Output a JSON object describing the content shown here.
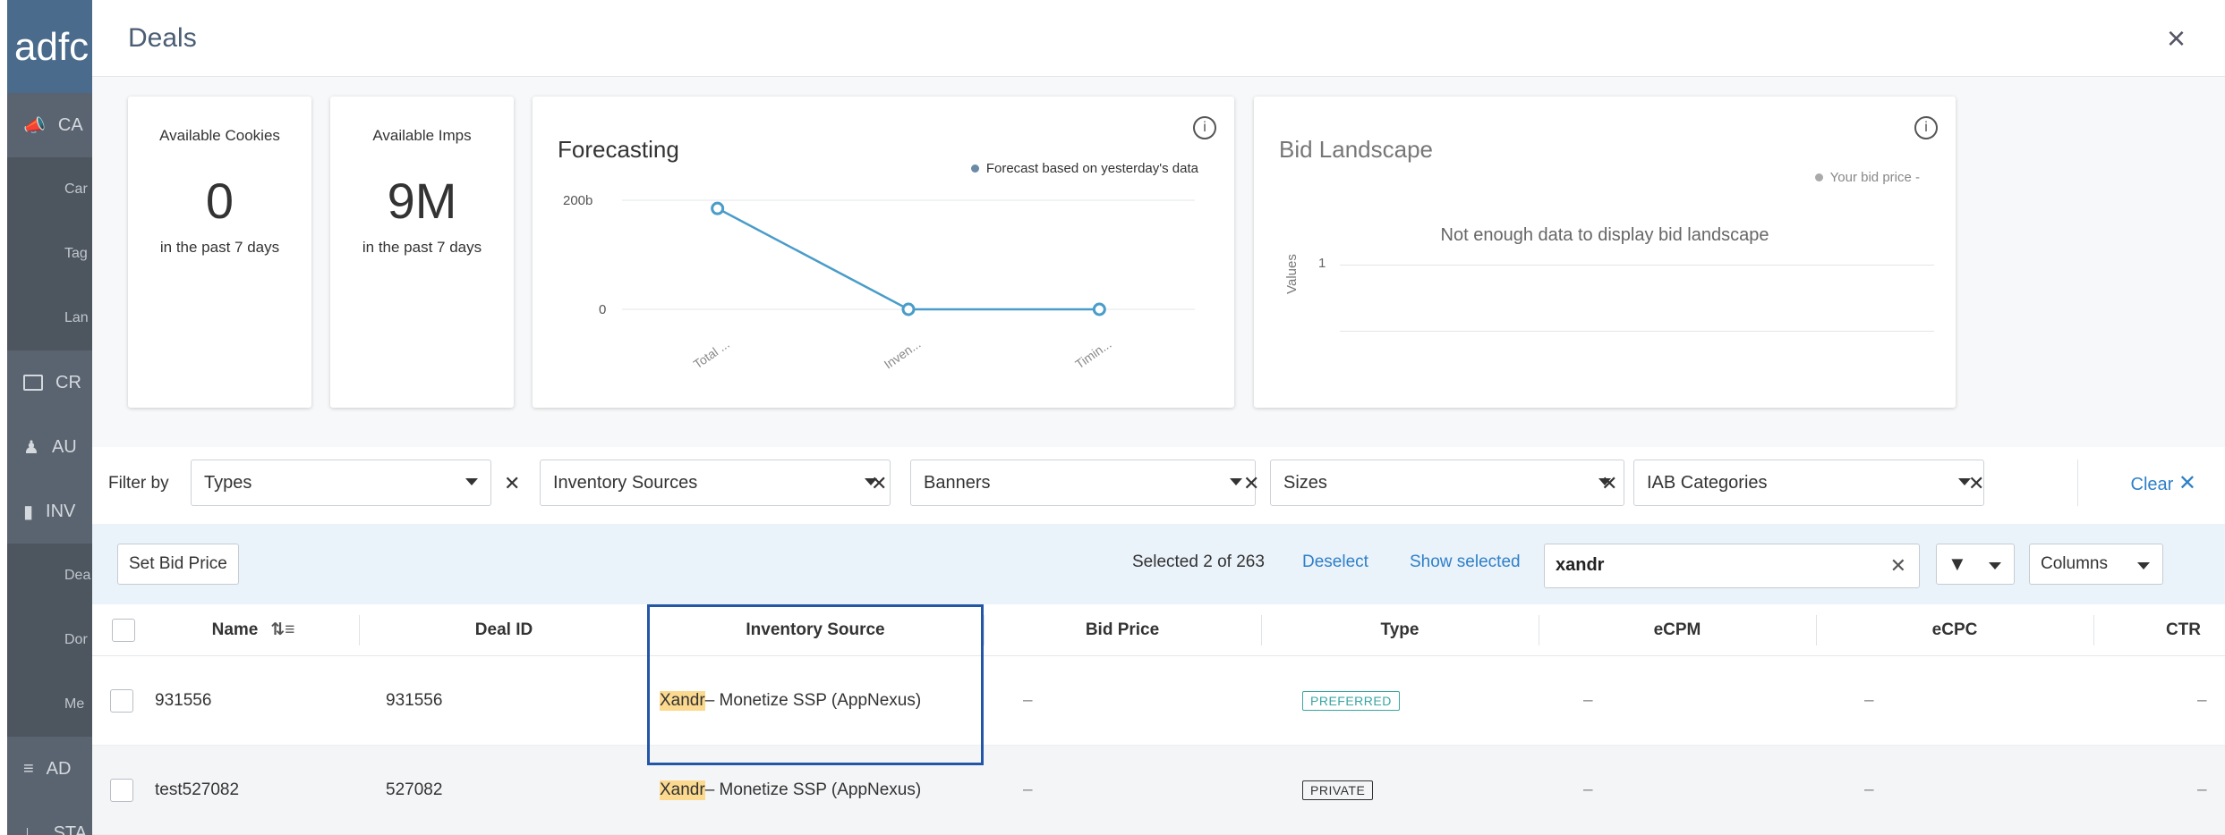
{
  "sidebar": {
    "logo": "adfc",
    "items": [
      {
        "label": "CA",
        "type": "main"
      },
      {
        "label": "Car",
        "type": "sub"
      },
      {
        "label": "Tag",
        "type": "sub"
      },
      {
        "label": "Lan",
        "type": "sub"
      },
      {
        "label": "CR",
        "type": "main"
      },
      {
        "label": "AU",
        "type": "main"
      },
      {
        "label": "INV",
        "type": "main"
      },
      {
        "label": "Dea",
        "type": "sub"
      },
      {
        "label": "Dor",
        "type": "sub"
      },
      {
        "label": "Me",
        "type": "sub"
      },
      {
        "label": "AD",
        "type": "main"
      },
      {
        "label": "STA",
        "type": "main"
      }
    ]
  },
  "modal": {
    "title": "Deals",
    "close": "×"
  },
  "stats": {
    "cookies": {
      "label": "Available Cookies",
      "value": "0",
      "sub": "in the past 7 days"
    },
    "imps": {
      "label": "Available Imps",
      "value": "9M",
      "sub": "in the past 7 days"
    }
  },
  "forecasting": {
    "title": "Forecasting",
    "legend": "Forecast based on yesterday's data",
    "info": "i"
  },
  "bid_landscape": {
    "title": "Bid Landscape",
    "legend": "Your bid price -",
    "message": "Not enough data to display bid landscape",
    "ylabel": "Values",
    "ytick": "1",
    "info": "i"
  },
  "chart_data": {
    "type": "line",
    "categories": [
      "Total ...",
      "Inven...",
      "Timin..."
    ],
    "series": [
      {
        "values": [
          185,
          0,
          0
        ]
      }
    ],
    "yticks": [
      "200b",
      "0"
    ],
    "ylim": [
      0,
      200
    ],
    "grid": true,
    "legend_position": "top-right",
    "color": "#4a9cc9"
  },
  "filters": {
    "label": "Filter by",
    "selects": [
      "Types",
      "Inventory Sources",
      "Banners",
      "Sizes",
      "IAB Categories"
    ],
    "clear": "Clear"
  },
  "toolbar": {
    "set_bid": "Set Bid Price",
    "selected": "Selected 2 of 263",
    "deselect": "Deselect",
    "show_selected": "Show selected",
    "search_value": "xandr",
    "columns": "Columns"
  },
  "table": {
    "headers": [
      "Name",
      "Deal ID",
      "Inventory Source",
      "Bid Price",
      "Type",
      "eCPM",
      "eCPC",
      "CTR"
    ],
    "rows": [
      {
        "name": "931556",
        "deal_id": "931556",
        "source_hl": "Xandr",
        "source_rest": "– Monetize SSP (AppNexus)",
        "bid": "–",
        "type": "PREFERRED",
        "ecpm": "–",
        "ecpc": "–",
        "ctr": "–"
      },
      {
        "name": "test527082",
        "deal_id": "527082",
        "source_hl": "Xandr",
        "source_rest": "– Monetize SSP (AppNexus)",
        "bid": "–",
        "type": "PRIVATE",
        "ecpm": "–",
        "ecpc": "–",
        "ctr": "–"
      }
    ]
  },
  "colors": {
    "accent": "#2f80c8",
    "preferred": "#3aa6a0",
    "private": "#333333",
    "highlight": "#fbd98f",
    "box": "#2456a8"
  }
}
